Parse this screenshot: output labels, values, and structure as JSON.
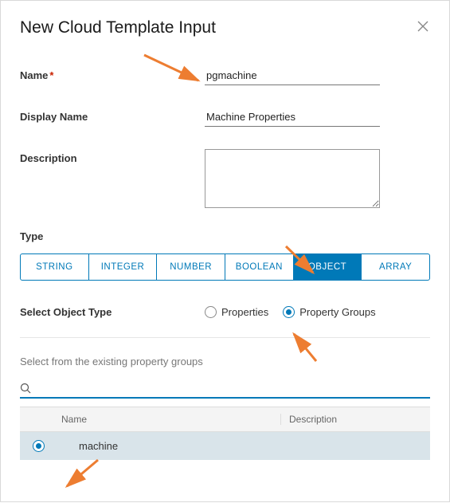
{
  "dialog": {
    "title": "New Cloud Template Input",
    "name_label": "Name",
    "name_value": "pgmachine",
    "display_name_label": "Display Name",
    "display_name_value": "Machine Properties",
    "description_label": "Description",
    "description_value": "",
    "type_label": "Type",
    "type_options": [
      "STRING",
      "INTEGER",
      "NUMBER",
      "BOOLEAN",
      "OBJECT",
      "ARRAY"
    ],
    "type_selected": "OBJECT",
    "object_type_label": "Select Object Type",
    "object_type_options": [
      "Properties",
      "Property Groups"
    ],
    "object_type_selected": "Property Groups",
    "pg_section_text": "Select from the existing property groups",
    "search_value": "",
    "table": {
      "headers": {
        "name": "Name",
        "description": "Description"
      },
      "rows": [
        {
          "name": "machine",
          "description": "",
          "selected": true
        }
      ]
    }
  }
}
